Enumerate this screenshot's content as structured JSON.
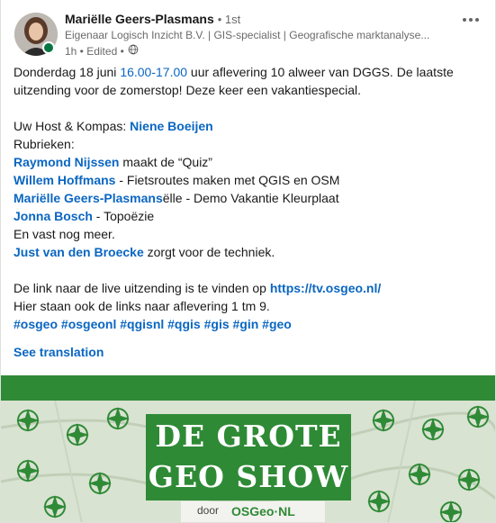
{
  "post": {
    "author": {
      "name": "Mariëlle Geers-Plasmans",
      "degree": "• 1st",
      "headline": "Eigenaar Logisch Inzicht B.V. | GIS-specialist | Geografische marktanalyse...",
      "meta": "1h • Edited •"
    },
    "body": {
      "line1_a": "Donderdag 18 juni ",
      "line1_time": "16.00-17.00",
      "line1_b": " uur aflevering 10 alweer van DGGS. De laatste",
      "line2": "uitzending dat voor de zomerstop! Deze keer een vakantiespecial.",
      "host_label": "Uw Host & Kompas: ",
      "host_name": "Niene Boeijen",
      "rubrieken": "Rubrieken:",
      "r1_name": "Raymond Nijssen",
      "r1_text": " maakt de “Quiz”",
      "r2_name": "Willem Hoffmans",
      "r2_text": " - Fietsroutes maken met QGIS en OSM",
      "r3_name": "Mariëlle Geers-Plasmans",
      "r3_text": "ëlle - Demo Vakantie Kleurplaat",
      "r4_name": "Jonna Bosch",
      "r4_text": " - Topoëzie",
      "more": "En vast nog meer.",
      "tech_name": "Just van den Broecke",
      "tech_text": " zorgt voor de techniek.",
      "link_text": "De link naar de live uitzending is te vinden op ",
      "link_url": "https://tv.osgeo.nl/",
      "links_line": "Hier staan ook de links naar aflevering 1 tm 9.",
      "hashtags": "#osgeo #osgeonl #qgisnl #qgis #gis #gin #geo"
    },
    "see_translation": "See translation",
    "banner": {
      "title_line1": "DE GROTE",
      "title_line2": "GEO SHOW",
      "door": "door",
      "logo_text": "OSGeo·NL"
    }
  },
  "colors": {
    "link": "#0a66c2",
    "banner_green": "#2f8a36",
    "online": "#057642"
  },
  "icons": [
    "more-options-icon",
    "globe-icon",
    "online-status-icon",
    "compass-icon"
  ]
}
